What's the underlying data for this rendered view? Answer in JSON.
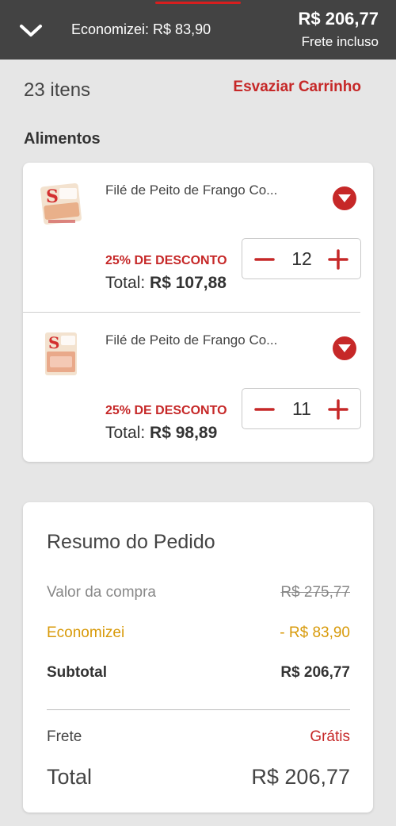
{
  "header": {
    "saved_text": "Economizei: R$ 83,90",
    "total": "R$ 206,77",
    "shipping_note": "Frete incluso"
  },
  "cart": {
    "count": "23 itens",
    "clear_label": "Esvaziar Carrinho",
    "section": "Alimentos",
    "items": [
      {
        "name": "Filé de Peito de Frango Co...",
        "discount": "25% DE DESCONTO",
        "total_label": "Total:",
        "total_value": "R$ 107,88",
        "quantity": "12"
      },
      {
        "name": "Filé de Peito de Frango Co...",
        "discount": "25% DE DESCONTO",
        "total_label": "Total:",
        "total_value": "R$ 98,89",
        "quantity": "11"
      }
    ]
  },
  "summary": {
    "title": "Resumo do Pedido",
    "purchase_label": "Valor da compra",
    "purchase_value": "R$ 275,77",
    "saved_label": "Economizei",
    "saved_value": "- R$ 83,90",
    "subtotal_label": "Subtotal",
    "subtotal_value": "R$ 206,77",
    "shipping_label": "Frete",
    "shipping_value": "Grátis",
    "total_label": "Total",
    "total_value": "R$ 206,77"
  },
  "colors": {
    "header_bg": "#434343",
    "accent_red": "#c62828",
    "savings_gold": "#d89a0a",
    "page_bg": "#e6e6e6"
  },
  "icons": {
    "collapse": "chevron-down-icon",
    "item_toggle": "caret-down-circle-icon",
    "decrement": "minus-icon",
    "increment": "plus-icon"
  }
}
